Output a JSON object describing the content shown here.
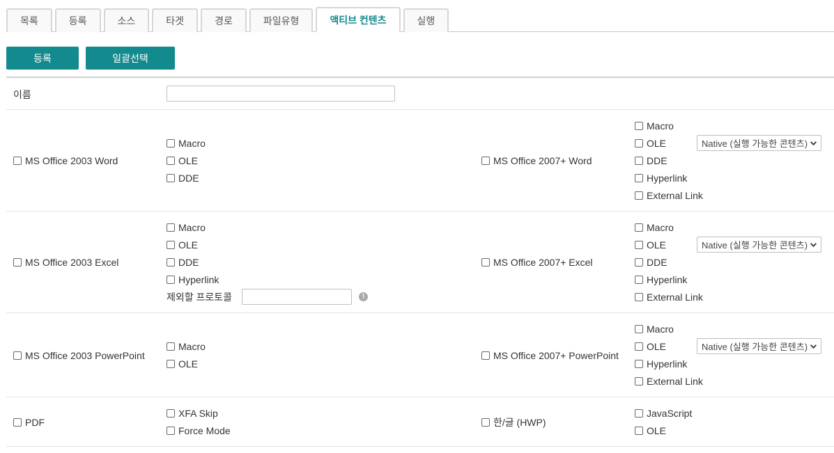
{
  "tabs": [
    {
      "label": "목록",
      "active": false
    },
    {
      "label": "등록",
      "active": false
    },
    {
      "label": "소스",
      "active": false
    },
    {
      "label": "타겟",
      "active": false
    },
    {
      "label": "경로",
      "active": false
    },
    {
      "label": "파일유형",
      "active": false
    },
    {
      "label": "액티브 컨텐츠",
      "active": true
    },
    {
      "label": "실행",
      "active": false
    }
  ],
  "toolbar": {
    "register_label": "등록",
    "select_all_label": "일괄선택"
  },
  "colors": {
    "accent": "#138a8e"
  },
  "form": {
    "name_label": "이름",
    "name_value": "",
    "rows": {
      "word": {
        "left": {
          "label": "MS Office 2003 Word",
          "checked": false,
          "options": [
            {
              "label": "Macro",
              "checked": false
            },
            {
              "label": "OLE",
              "checked": false
            },
            {
              "label": "DDE",
              "checked": false
            }
          ]
        },
        "right": {
          "label": "MS Office 2007+ Word",
          "checked": false,
          "options": [
            {
              "label": "Macro",
              "checked": false
            },
            {
              "label": "OLE",
              "checked": false
            },
            {
              "label": "DDE",
              "checked": false
            },
            {
              "label": "Hyperlink",
              "checked": false
            },
            {
              "label": "External Link",
              "checked": false
            }
          ],
          "ole_mode": "Native (실행 가능한 콘텐츠)"
        }
      },
      "excel": {
        "left": {
          "label": "MS Office 2003 Excel",
          "checked": false,
          "options": [
            {
              "label": "Macro",
              "checked": false
            },
            {
              "label": "OLE",
              "checked": false
            },
            {
              "label": "DDE",
              "checked": false
            },
            {
              "label": "Hyperlink",
              "checked": false
            }
          ],
          "exclude_protocol_label": "제외할 프로토콜",
          "exclude_protocol_value": "",
          "info_icon": "info-icon"
        },
        "right": {
          "label": "MS Office 2007+ Excel",
          "checked": false,
          "options": [
            {
              "label": "Macro",
              "checked": false
            },
            {
              "label": "OLE",
              "checked": false
            },
            {
              "label": "DDE",
              "checked": false
            },
            {
              "label": "Hyperlink",
              "checked": false
            },
            {
              "label": "External Link",
              "checked": false
            }
          ],
          "ole_mode": "Native (실행 가능한 콘텐츠)"
        }
      },
      "powerpoint": {
        "left": {
          "label": "MS Office 2003 PowerPoint",
          "checked": false,
          "options": [
            {
              "label": "Macro",
              "checked": false
            },
            {
              "label": "OLE",
              "checked": false
            }
          ]
        },
        "right": {
          "label": "MS Office 2007+ PowerPoint",
          "checked": false,
          "options": [
            {
              "label": "Macro",
              "checked": false
            },
            {
              "label": "OLE",
              "checked": false
            },
            {
              "label": "Hyperlink",
              "checked": false
            },
            {
              "label": "External Link",
              "checked": false
            }
          ],
          "ole_mode": "Native (실행 가능한 콘텐츠)"
        }
      },
      "pdf_hwp": {
        "left": {
          "label": "PDF",
          "checked": false,
          "options": [
            {
              "label": "XFA Skip",
              "checked": false
            },
            {
              "label": "Force Mode",
              "checked": false
            }
          ]
        },
        "right": {
          "label": "한/글 (HWP)",
          "checked": false,
          "options": [
            {
              "label": "JavaScript",
              "checked": false
            },
            {
              "label": "OLE",
              "checked": false
            }
          ]
        }
      }
    }
  }
}
